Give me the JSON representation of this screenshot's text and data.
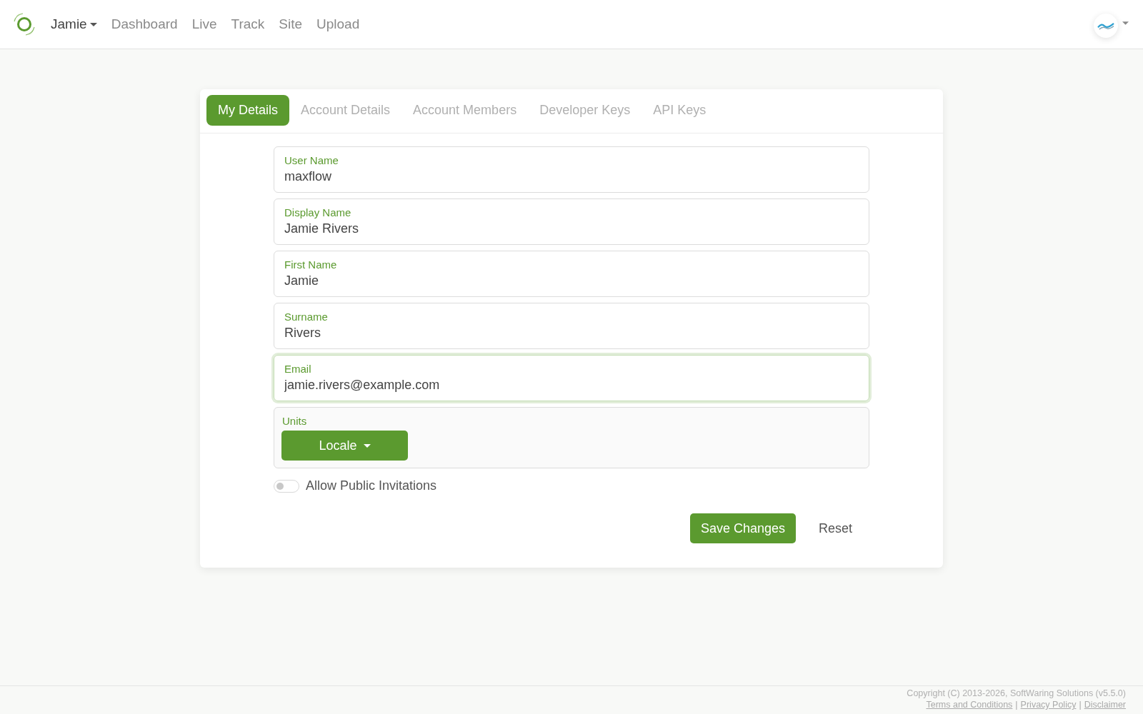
{
  "header": {
    "user_menu": {
      "label": "Jamie"
    },
    "nav": [
      {
        "label": "Dashboard"
      },
      {
        "label": "Live"
      },
      {
        "label": "Track"
      },
      {
        "label": "Site"
      },
      {
        "label": "Upload"
      }
    ]
  },
  "tabs": [
    {
      "label": "My Details",
      "selected": true
    },
    {
      "label": "Account Details",
      "selected": false
    },
    {
      "label": "Account Members",
      "selected": false
    },
    {
      "label": "Developer Keys",
      "selected": false
    },
    {
      "label": "API Keys",
      "selected": false
    }
  ],
  "fields": [
    {
      "label": "User Name",
      "value": "maxflow",
      "focused": false
    },
    {
      "label": "Display Name",
      "value": "Jamie Rivers",
      "focused": false
    },
    {
      "label": "First Name",
      "value": "Jamie",
      "focused": false
    },
    {
      "label": "Surname",
      "value": "Rivers",
      "focused": false
    },
    {
      "label": "Email",
      "value": "jamie.rivers@example.com",
      "focused": true
    }
  ],
  "units": {
    "label": "Units",
    "button": "Locale"
  },
  "public_invitations": {
    "label": "Allow Public Invitations",
    "on": false
  },
  "actions": {
    "save": "Save Changes",
    "reset": "Reset"
  },
  "footer": {
    "copyright": "Copyright (C) 2013-2026, SoftWaring Solutions (v5.5.0)",
    "links": [
      "Terms and Conditions",
      "Privacy Policy",
      "Disclaimer"
    ],
    "separators": [
      "|",
      "|"
    ]
  }
}
